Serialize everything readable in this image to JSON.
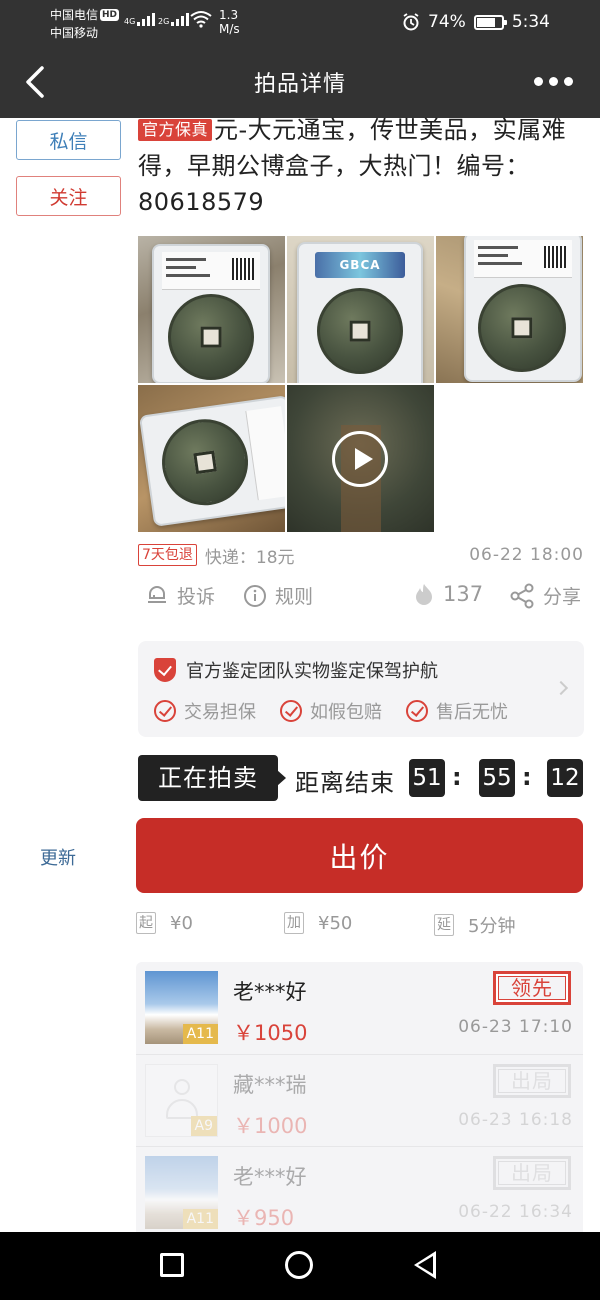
{
  "status_bar": {
    "carrier1": "中国电信",
    "hd": "HD",
    "carrier2": "中国移动",
    "net1": "4G",
    "net2": "2G",
    "speed": "1.3",
    "speed_unit": "M/s",
    "battery": "74%",
    "battery_level": 0.74,
    "time": "5:34"
  },
  "nav": {
    "title": "拍品详情"
  },
  "side": {
    "message_label": "私信",
    "follow_label": "关注",
    "update_label": "更新"
  },
  "item": {
    "official_tag": "官方保真",
    "title": "元-大元通宝，传世美品，实属难得，早期公博盒子，大热门！编号：80618579",
    "free_return_tag": "7天包退",
    "shipping": "快递：18元",
    "listed_time": "06-22  18:00",
    "photo_gbca_label": "GBCA"
  },
  "actions": {
    "complain": "投诉",
    "rules": "规则",
    "hot_count": "137",
    "share": "分享"
  },
  "guarantee": {
    "title": "官方鉴定团队实物鉴定保驾护航",
    "items": [
      "交易担保",
      "如假包赔",
      "售后无忧"
    ]
  },
  "auction": {
    "status": "正在拍卖",
    "countdown_label": "距离结束",
    "hours": "51",
    "minutes": "55",
    "seconds": "12",
    "separator": ":"
  },
  "bid_button": {
    "label": "出价"
  },
  "params": {
    "start_tag": "起",
    "start_value": "¥0",
    "increment_tag": "加",
    "increment_value": "¥50",
    "extend_tag": "延",
    "extend_value": "5分钟"
  },
  "bids": [
    {
      "name": "老***好",
      "price": "￥1050",
      "time": "06-23  17:10",
      "level": "A11",
      "stamp": "领先"
    },
    {
      "name": "藏***瑞",
      "price": "￥1000",
      "time": "06-23  16:18",
      "level": "A9",
      "stamp": "出局"
    },
    {
      "name": "老***好",
      "price": "￥950",
      "time": "06-22  16:34",
      "level": "A11",
      "stamp": "出局"
    }
  ],
  "colors": {
    "accent": "#c62d27",
    "topbar": "#333333",
    "link_blue": "#3f7fb8",
    "badge_gold": "#e5b94c"
  }
}
